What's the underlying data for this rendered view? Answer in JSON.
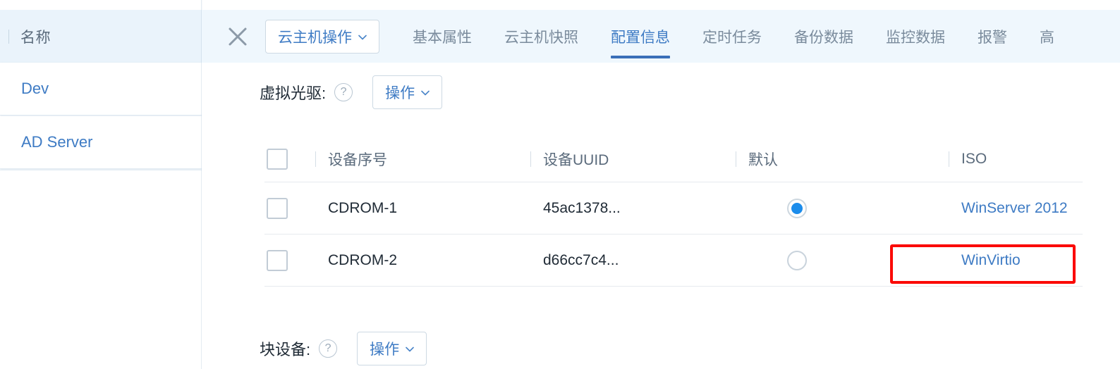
{
  "sidebar": {
    "header_label": "名称",
    "items": [
      {
        "label": "Dev"
      },
      {
        "label": "AD Server"
      }
    ]
  },
  "tabbar": {
    "close_icon": "close-icon",
    "action_button": {
      "label": "云主机操作",
      "caret_icon": "chevron-down-icon"
    },
    "tabs": [
      {
        "label": "基本属性",
        "active": false
      },
      {
        "label": "云主机快照",
        "active": false
      },
      {
        "label": "配置信息",
        "active": true
      },
      {
        "label": "定时任务",
        "active": false
      },
      {
        "label": "备份数据",
        "active": false
      },
      {
        "label": "监控数据",
        "active": false
      },
      {
        "label": "报警",
        "active": false
      },
      {
        "label": "高",
        "active": false
      }
    ]
  },
  "content": {
    "cdrom_section": {
      "label": "虚拟光驱:",
      "help_icon": "question-mark-icon",
      "help_glyph": "?",
      "action_button": {
        "label": "操作",
        "caret_icon": "chevron-down-icon"
      },
      "table": {
        "columns": [
          "",
          "设备序号",
          "设备UUID",
          "默认",
          "ISO"
        ],
        "rows": [
          {
            "selected": false,
            "serial": "CDROM-1",
            "uuid": "45ac1378...",
            "is_default": true,
            "iso": "WinServer 2012"
          },
          {
            "selected": false,
            "serial": "CDROM-2",
            "uuid": "d66cc7c4...",
            "is_default": false,
            "iso": "WinVirtio"
          }
        ]
      }
    },
    "blockdev_section": {
      "label": "块设备:",
      "help_icon": "question-mark-icon",
      "help_glyph": "?",
      "action_button": {
        "label": "操作",
        "caret_icon": "chevron-down-icon"
      }
    }
  },
  "annotation": {
    "target": "WinVirtio",
    "color": "#fb0a06"
  },
  "colors": {
    "accent_blue": "#3e7bc4",
    "tabbar_bg": "#eff7fd",
    "sidebar_header_bg": "#eaf3fb",
    "radio_blue": "#1b8ceb",
    "annotation_red": "#fb0a06"
  }
}
